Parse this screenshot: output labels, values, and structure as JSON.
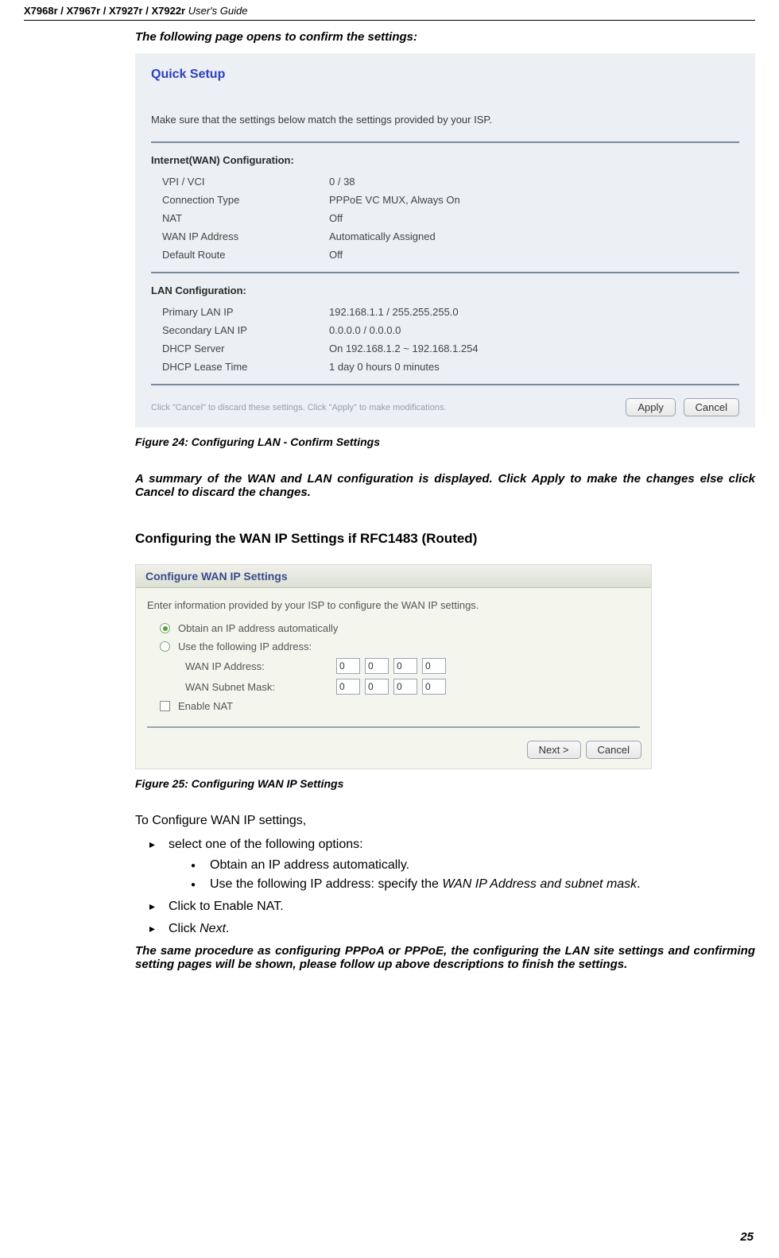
{
  "header": {
    "models": "X7968r / X7967r / X7927r / X7922r",
    "guide": " User's Guide"
  },
  "intro": "The following page opens to confirm the settings:",
  "quicksetup": {
    "title": "Quick Setup",
    "note": "Make sure that the settings below match the settings provided by your ISP.",
    "wan_heading": "Internet(WAN) Configuration:",
    "wan": [
      {
        "k": "VPI / VCI",
        "v": "0 / 38"
      },
      {
        "k": "Connection Type",
        "v": "PPPoE   VC MUX,   Always On"
      },
      {
        "k": "NAT",
        "v": "Off"
      },
      {
        "k": "WAN IP Address",
        "v": "Automatically Assigned"
      },
      {
        "k": "Default Route",
        "v": "Off"
      }
    ],
    "lan_heading": "LAN Configuration:",
    "lan": [
      {
        "k": "Primary LAN IP",
        "v": "192.168.1.1 / 255.255.255.0"
      },
      {
        "k": "Secondary LAN IP",
        "v": "0.0.0.0 / 0.0.0.0"
      },
      {
        "k": "DHCP Server",
        "v": "On 192.168.1.2 ~ 192.168.1.254"
      },
      {
        "k": "DHCP Lease Time",
        "v": "1 day 0 hours 0 minutes"
      }
    ],
    "hint": "Click \"Cancel\" to discard these settings. Click \"Apply\" to make modifications.",
    "apply": "Apply",
    "cancel": "Cancel"
  },
  "caption1": "Figure 24: Configuring LAN - Confirm Settings",
  "summary": "A summary of the WAN and LAN configuration is displayed. Click Apply to make the changes else click Cancel to discard the changes.",
  "h3": "Configuring the WAN IP Settings if RFC1483 (Routed)",
  "wanip": {
    "title": "Configure WAN IP Settings",
    "note": "Enter information provided by your ISP to configure the WAN IP settings.",
    "opt_auto": "Obtain an IP address automatically",
    "opt_manual": "Use the following IP address:",
    "ip_label": "WAN IP Address:",
    "mask_label": "WAN Subnet Mask:",
    "ip_values": [
      "0",
      "0",
      "0",
      "0"
    ],
    "mask_values": [
      "0",
      "0",
      "0",
      "0"
    ],
    "enable_nat": "Enable NAT",
    "next": "Next >",
    "cancel": "Cancel"
  },
  "caption2": "Figure 25: Configuring WAN IP Settings",
  "body1": "To Configure WAN IP settings,",
  "list": {
    "item1": "select one of the following options:",
    "sub1": "Obtain an IP address automatically.",
    "sub2_a": "Use the following IP address: specify the ",
    "sub2_b": "WAN IP Address and subnet mask",
    "sub2_c": ".",
    "item2": "Click to Enable NAT.",
    "item3_a": "Click ",
    "item3_b": "Next",
    "item3_c": "."
  },
  "final": "The same procedure as configuring PPPoA or PPPoE, the configuring the LAN site settings and confirming setting pages will be shown, please follow up above descriptions to finish the settings.",
  "page_num": "25"
}
